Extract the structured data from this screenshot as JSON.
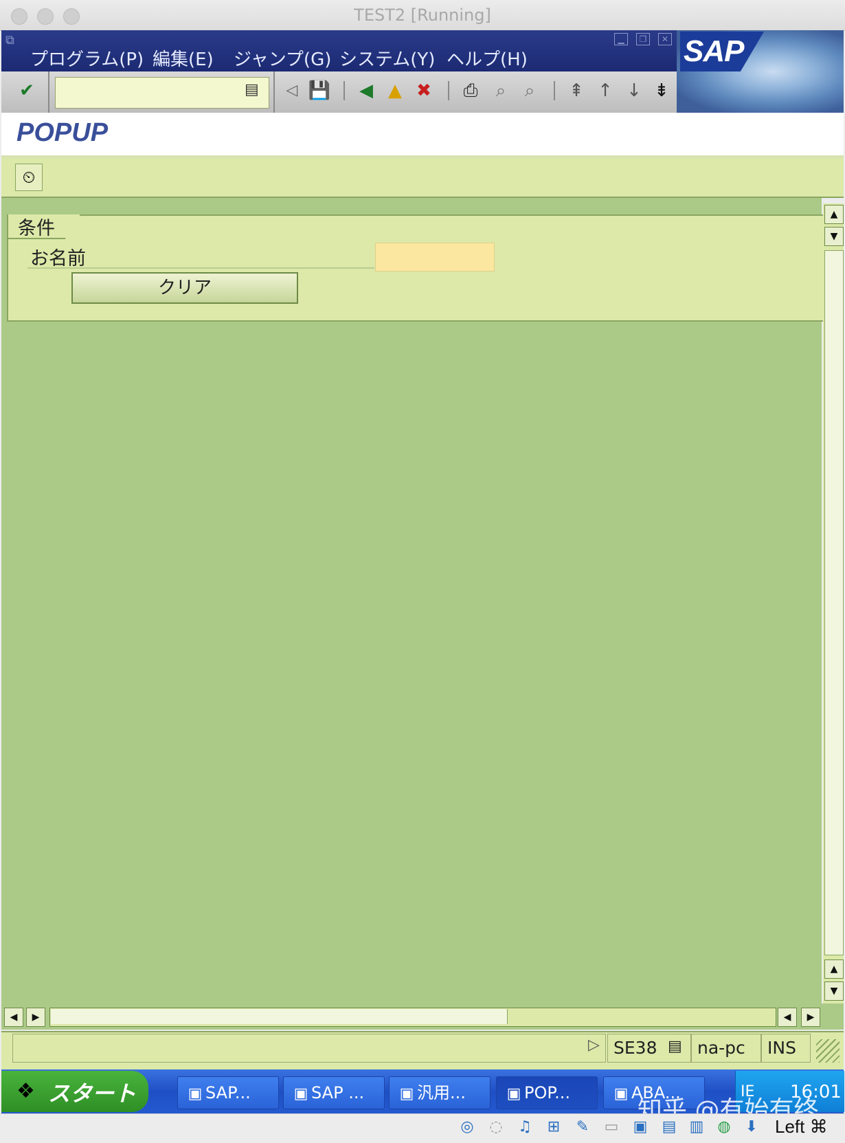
{
  "window": {
    "title": "TEST2 [Running]"
  },
  "menu": {
    "items": [
      "プログラム(P)",
      "編集(E)",
      "ジャンプ(G)",
      "システム(Y)",
      "ヘルプ(H)"
    ]
  },
  "brand": {
    "logo_text": "SAP"
  },
  "toolbar": {
    "command_field_value": "",
    "icons": [
      "enter-icon",
      "back-arrow-icon",
      "save-icon",
      "back-icon",
      "exit-icon",
      "cancel-icon",
      "print-icon",
      "find-icon",
      "find-next-icon",
      "first-page-icon",
      "prev-page-icon",
      "next-page-icon",
      "last-page-icon"
    ]
  },
  "screen": {
    "title": "POPUP"
  },
  "app_toolbar": {
    "execute_icon": "execute-clock-icon"
  },
  "form": {
    "frame_label": "条件",
    "name_label": "お名前",
    "name_value": "",
    "clear_button": "クリア"
  },
  "status": {
    "message": "",
    "transaction": "SE38",
    "host": "na-pc",
    "mode": "INS"
  },
  "taskbar": {
    "start_label": "スタート",
    "tasks": [
      "SAP...",
      "SAP ...",
      "汎用...",
      "POP...",
      "ABA..."
    ],
    "tray_text": "IE",
    "clock": "16:01",
    "watermark": "知乎 @有始有终"
  },
  "vm": {
    "key_label": "Left ⌘"
  },
  "colors": {
    "menubar": "#1c2a72",
    "form_bg": "#dce9a9",
    "main_bg": "#abca88",
    "input_bg": "#fbe7a0",
    "taskbar": "#1f4fc4"
  }
}
